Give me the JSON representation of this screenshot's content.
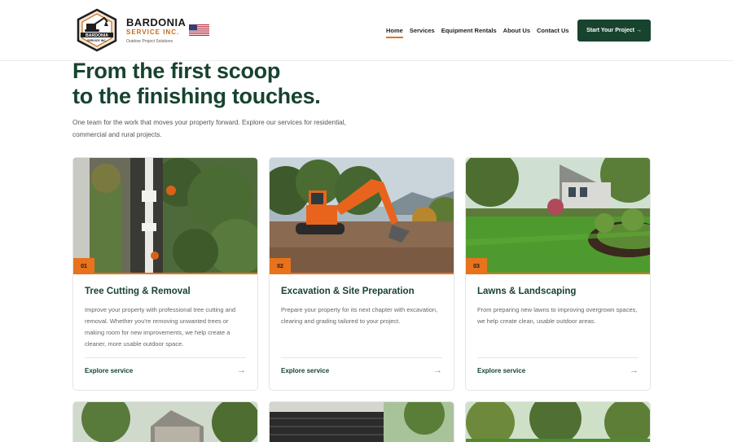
{
  "brand": {
    "name": "BARDONIA",
    "sub": "SERVICE INC.",
    "tagline": "Outdoor Project Solutions",
    "logo_text_top": "BARDONIA",
    "logo_text_bottom": "SERVICE INC."
  },
  "nav": {
    "items": [
      {
        "label": "Home",
        "active": true
      },
      {
        "label": "Services",
        "active": false
      },
      {
        "label": "Equipment Rentals",
        "active": false
      },
      {
        "label": "About Us",
        "active": false
      },
      {
        "label": "Contact Us",
        "active": false
      }
    ],
    "cta_label": "Start Your Project",
    "cta_arrow": "→"
  },
  "hero": {
    "line1": "From the first scoop",
    "line2": "to the finishing touches.",
    "description": "One team for the work that moves your property forward. Explore our services for residential, commercial and rural projects."
  },
  "cards": [
    {
      "number": "01",
      "title": "Tree Cutting & Removal",
      "description": "Improve your property with professional tree cutting and removal. Whether you're removing unwanted trees or making room for new improvements, we help create a cleaner, more usable outdoor space.",
      "link": "Explore service",
      "arrow": "→"
    },
    {
      "number": "02",
      "title": "Excavation & Site Preparation",
      "description": "Prepare your property for its next chapter with excavation, clearing and grading tailored to your project.",
      "link": "Explore service",
      "arrow": "→"
    },
    {
      "number": "03",
      "title": "Lawns & Landscaping",
      "description": "From preparing new lawns to improving overgrown spaces, we help create clean, usable outdoor areas.",
      "link": "Explore service",
      "arrow": "→"
    }
  ],
  "colors": {
    "brand_green": "#17432f",
    "accent_orange": "#e8731c"
  }
}
